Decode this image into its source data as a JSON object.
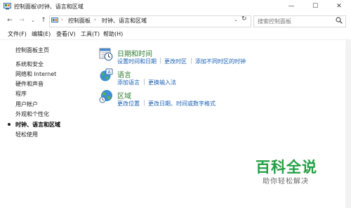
{
  "window": {
    "title": "控制面板\\时钟、语言和区域",
    "minimize": "—",
    "maximize": "☐",
    "close": "✕"
  },
  "nav": {
    "back": "←",
    "forward": "→",
    "dropdown": "⌄",
    "up": "↑",
    "breadcrumb": [
      "控制面板",
      "时钟、语言和区域"
    ],
    "separator": "›",
    "lead_arrow": "›",
    "address_dropdown": "⌄",
    "refresh": "↻",
    "search_placeholder": "搜索控制面板"
  },
  "menubar": {
    "file": "文件(F)",
    "edit": "编辑(E)",
    "view": "查看(V)",
    "tools": "工具(T)",
    "help": "帮助(H)"
  },
  "sidebar": {
    "home": "控制面板主页",
    "items": [
      {
        "label": "系统和安全"
      },
      {
        "label": "网络和 Internet"
      },
      {
        "label": "硬件和声音"
      },
      {
        "label": "程序"
      },
      {
        "label": "用户帐户"
      },
      {
        "label": "外观和个性化"
      },
      {
        "label": "时钟、语言和区域",
        "active": true
      },
      {
        "label": "轻松使用"
      }
    ]
  },
  "categories": [
    {
      "title": "日期和时间",
      "icon": "clock-calendar-icon",
      "links": [
        "设置时间和日期",
        "更改时区",
        "添加不同时区的时钟"
      ]
    },
    {
      "title": "语言",
      "icon": "language-globe-icon",
      "links": [
        "添加语言",
        "更换输入法"
      ]
    },
    {
      "title": "区域",
      "icon": "region-globe-icon",
      "links": [
        "更改位置",
        "更改日期、时间或数字格式"
      ]
    }
  ],
  "watermark": {
    "title": "百科全说",
    "subtitle": "助你轻松解决"
  },
  "colors": {
    "category_title": "#2e7d32",
    "link": "#1a5fb4",
    "watermark": "#22a045"
  }
}
